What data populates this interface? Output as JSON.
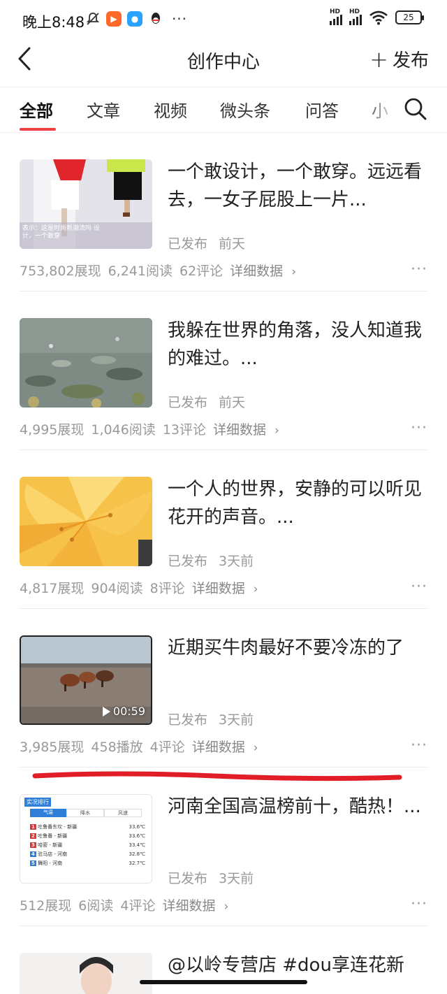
{
  "status_bar": {
    "time": "晚上8:48",
    "battery": "25",
    "left_icons": [
      "mute-bell-icon",
      "video-app-icon",
      "chat-app-icon",
      "qq-icon",
      "more-dots-icon"
    ],
    "signal_label": "HD"
  },
  "nav": {
    "title": "创作中心",
    "publish_label": "发布"
  },
  "tabs": [
    {
      "label": "全部",
      "active": true
    },
    {
      "label": "文章"
    },
    {
      "label": "视频"
    },
    {
      "label": "微头条"
    },
    {
      "label": "问答"
    },
    {
      "label": "小"
    }
  ],
  "colors": {
    "accent": "#f04142",
    "meta": "#999999"
  },
  "items": [
    {
      "title": "一个敢设计，一个敢穿。远远看去，一女子屁股上一片...",
      "status": "已发布",
      "time": "前天",
      "impressions": "753,802展现",
      "reads": "6,241阅读",
      "comments": "62评论",
      "detail": "详细数据",
      "thumb_caption": "表示：这是时尚新潮流吗 设计，一个敢穿"
    },
    {
      "title": "我躲在世界的角落，没人知道我的难过。...",
      "status": "已发布",
      "time": "前天",
      "impressions": "4,995展现",
      "reads": "1,046阅读",
      "comments": "13评论",
      "detail": "详细数据"
    },
    {
      "title": "一个人的世界，安静的可以听见花开的声音。...",
      "status": "已发布",
      "time": "3天前",
      "impressions": "4,817展现",
      "reads": "904阅读",
      "comments": "8评论",
      "detail": "详细数据"
    },
    {
      "title": "近期买牛肉最好不要冷冻的了",
      "status": "已发布",
      "time": "3天前",
      "impressions": "3,985展现",
      "reads": "458播放",
      "comments": "4评论",
      "detail": "详细数据",
      "duration": "00:59"
    },
    {
      "title": "河南全国高温榜前十，酷热！...",
      "status": "已发布",
      "time": "3天前",
      "impressions": "512展现",
      "reads": "6阅读",
      "comments": "4评论",
      "detail": "详细数据",
      "thumb": {
        "header": "实况排行",
        "tabs": [
          "气温",
          "降水",
          "风速"
        ],
        "rows": [
          {
            "rank": "1",
            "place": "吐鲁番东坎 - 新疆",
            "temp": "33.6℃"
          },
          {
            "rank": "2",
            "place": "吐鲁番 - 新疆",
            "temp": "33.6℃"
          },
          {
            "rank": "3",
            "place": "哈密 - 新疆",
            "temp": "33.4℃"
          },
          {
            "rank": "4",
            "place": "驻马店 - 河南",
            "temp": "32.8℃"
          },
          {
            "rank": "5",
            "place": "舞阳 - 河南",
            "temp": "32.7℃"
          }
        ]
      }
    },
    {
      "title": "@以岭专营店 #dou享连花新"
    }
  ]
}
